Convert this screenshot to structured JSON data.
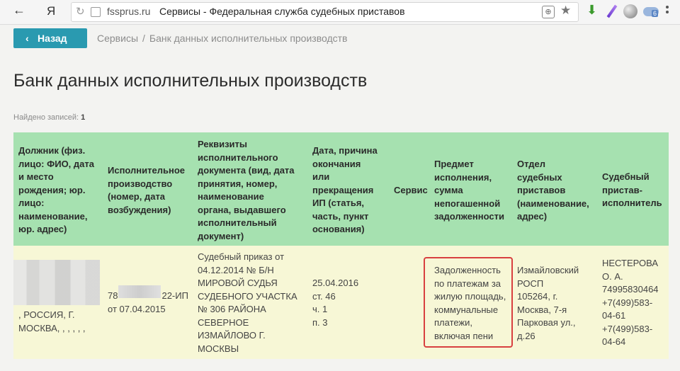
{
  "browser": {
    "back_glyph": "←",
    "yandex_logo": "Я",
    "domain": "fssprus.ru",
    "page_title": "Сервисы - Федеральная служба судебных приставов",
    "ext_badge": "6"
  },
  "nav": {
    "back_label": "Назад",
    "breadcrumb": [
      "Сервисы",
      "Банк данных исполнительных производств"
    ]
  },
  "page": {
    "title": "Банк данных исполнительных производств",
    "found_label": "Найдено записей:",
    "found_count": "1"
  },
  "table": {
    "headers": [
      [
        "Должник (физ.",
        "лицо: ФИО, дата",
        "и место",
        "рождения; юр.",
        "лицо:",
        "наименование,",
        "юр. адрес)"
      ],
      [
        "Исполнительное",
        "производство",
        "(номер, дата",
        "возбуждения)"
      ],
      [
        "Реквизиты",
        "исполнительного",
        "документа (вид, дата",
        "принятия, номер,",
        "наименование",
        "органа, выдавшего",
        "исполнительный",
        "документ)"
      ],
      [
        "Дата, причина",
        "окончания",
        "или",
        "прекращения",
        "ИП (статья,",
        "часть, пункт",
        "основания)"
      ],
      [
        "Сервис"
      ],
      [
        "Предмет",
        "исполнения,",
        "сумма",
        "непогашенной",
        "задолженности"
      ],
      [
        "Отдел",
        "судебных",
        "приставов",
        "(наименование,",
        "адрес)"
      ],
      [
        "Судебный",
        "пристав-",
        "исполнитель"
      ]
    ],
    "row": {
      "debtor": [
        ", РОССИЯ, Г.",
        "МОСКВА, , , , , ,"
      ],
      "proceeding": [
        "78",
        "22-ИП",
        "от 07.04.2015"
      ],
      "document": [
        "Судебный приказ от",
        "04.12.2014 № Б/Н",
        "МИРОВОЙ СУДЬЯ",
        "СУДЕБНОГО УЧАСТКА",
        "№ 306 РАЙОНА",
        "СЕВЕРНОЕ",
        "ИЗМАЙЛОВО Г.",
        "МОСКВЫ"
      ],
      "end_date": [
        "25.04.2016",
        "ст. 46",
        "ч. 1",
        "п. 3"
      ],
      "service": "",
      "subject": [
        "Задолженность",
        "по платежам за",
        "жилую площадь,",
        "коммунальные",
        "платежи,",
        "включая пени"
      ],
      "department": [
        "Измайловский",
        "РОСП",
        "105264, г.",
        "Москва, 7-я",
        "Парковая ул.,",
        "д.26"
      ],
      "bailiff": [
        "НЕСТЕРОВА",
        "О. А.",
        "74995830464",
        "+7(499)583-",
        "04-61",
        "+7(499)583-",
        "04-64"
      ]
    }
  }
}
